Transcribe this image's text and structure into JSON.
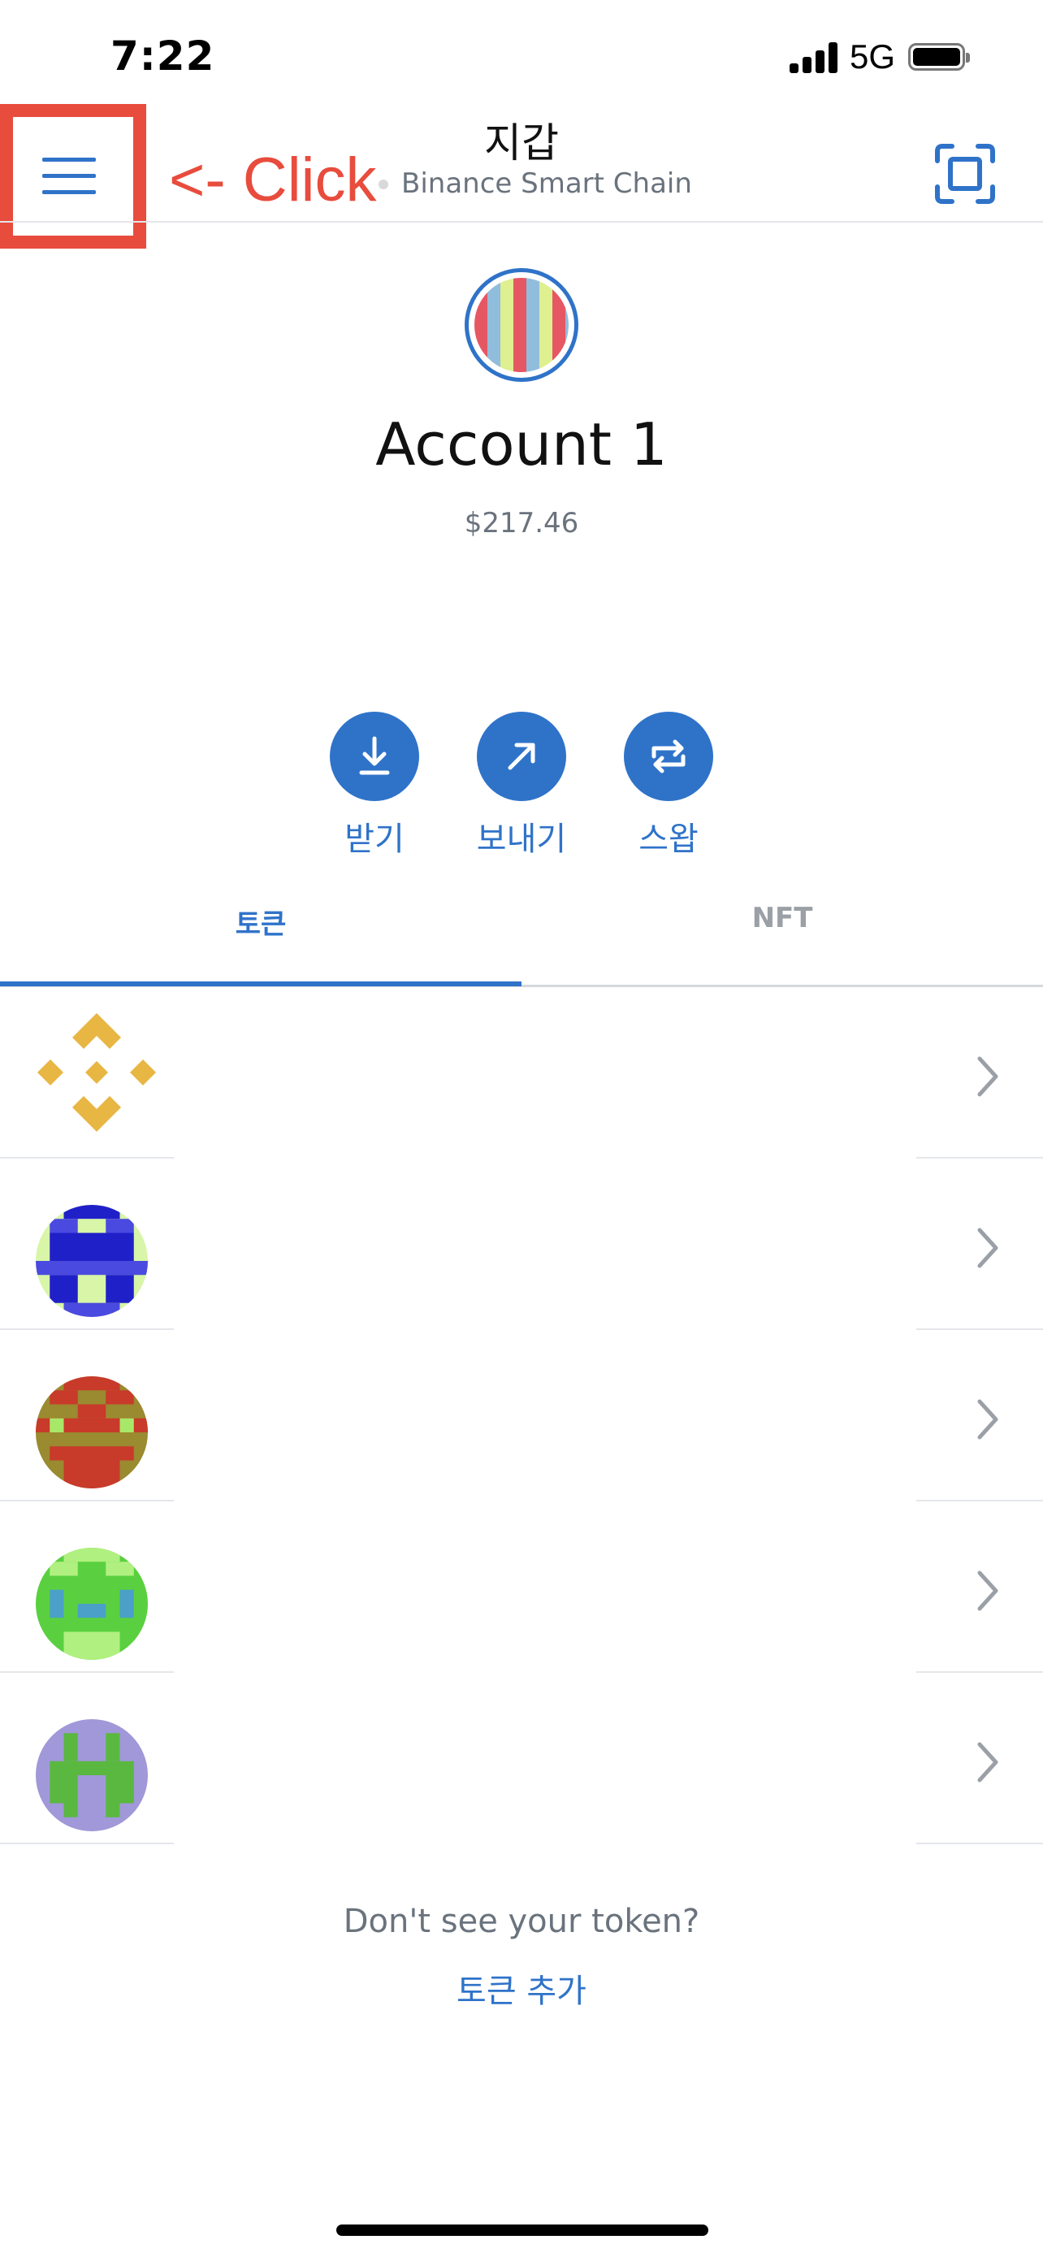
{
  "status_bar": {
    "time": "7:22",
    "network_type": "5G"
  },
  "header": {
    "title": "지갑",
    "network_name": "Binance Smart Chain",
    "menu_icon": "hamburger-menu-icon",
    "scan_icon": "qr-scan-icon",
    "annotation": "<- Click"
  },
  "account": {
    "name": "Account 1",
    "balance": "$217.46"
  },
  "actions": [
    {
      "label": "받기",
      "icon": "download-arrow-icon"
    },
    {
      "label": "보내기",
      "icon": "send-arrow-icon"
    },
    {
      "label": "스왑",
      "icon": "swap-arrows-icon"
    }
  ],
  "tabs": [
    {
      "label": "토큰",
      "active": true
    },
    {
      "label": "NFT",
      "active": false
    }
  ],
  "tokens": [
    {
      "icon": "binance-logo-icon"
    },
    {
      "icon": "blue-pixel-avatar-icon"
    },
    {
      "icon": "red-pixel-avatar-icon"
    },
    {
      "icon": "green-pixel-avatar-icon"
    },
    {
      "icon": "purple-pixel-avatar-icon"
    }
  ],
  "footer": {
    "missing_token_text": "Don't see your token?",
    "add_token_link": "토큰 추가"
  },
  "colors": {
    "accent": "#2f73c9",
    "annotation": "#e84c3d",
    "muted_text": "#6a737d",
    "binance_gold": "#e8b643"
  }
}
